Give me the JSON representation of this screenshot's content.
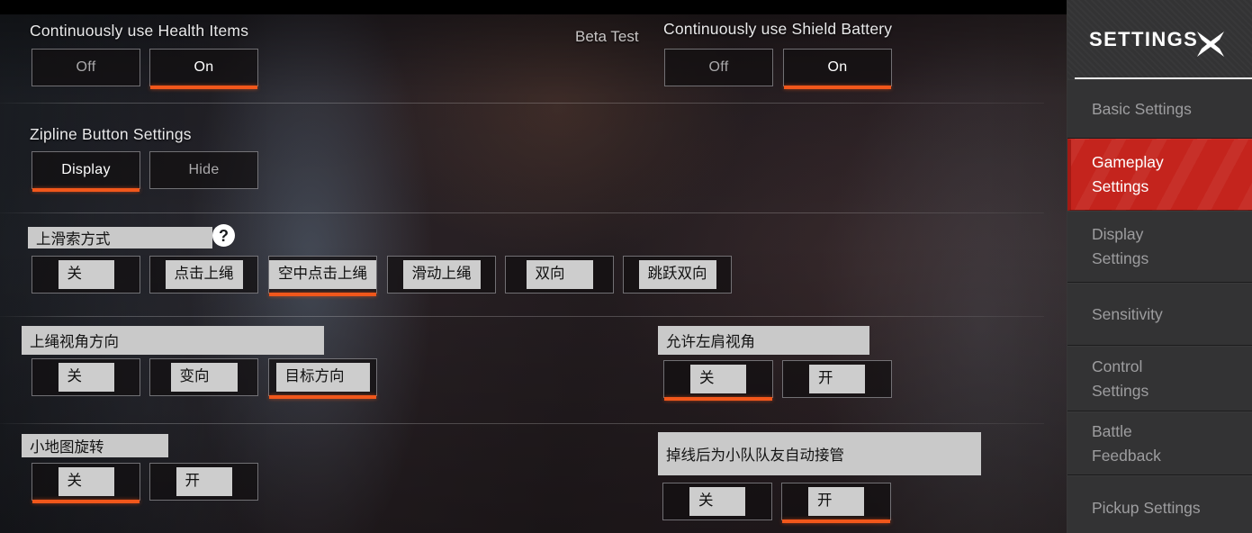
{
  "window": {
    "beta_label": "Beta Test"
  },
  "sidebar": {
    "title": "SETTINGS",
    "close_icon": "close-x-icon",
    "items": [
      {
        "label": "Basic Settings",
        "active": false
      },
      {
        "label": "Gameplay\nSettings",
        "active": true
      },
      {
        "label": "Display\nSettings",
        "active": false
      },
      {
        "label": "Sensitivity",
        "active": false
      },
      {
        "label": "Control\nSettings",
        "active": false
      },
      {
        "label": "Battle\nFeedback",
        "active": false
      },
      {
        "label": "Pickup Settings",
        "active": false
      }
    ]
  },
  "settings": [
    {
      "id": "continuously-use-health-items",
      "title": "Continuously use Health Items",
      "options": [
        {
          "label": "Off",
          "selected": false
        },
        {
          "label": "On",
          "selected": true
        }
      ]
    },
    {
      "id": "continuously-use-shield-battery",
      "title": "Continuously use Shield Battery",
      "options": [
        {
          "label": "Off",
          "selected": false
        },
        {
          "label": "On",
          "selected": true
        }
      ]
    },
    {
      "id": "zipline-button-settings",
      "title": "Zipline Button Settings",
      "options": [
        {
          "label": "Display",
          "selected": true
        },
        {
          "label": "Hide",
          "selected": false
        }
      ]
    },
    {
      "id": "zipline-mount-method",
      "title": "上滑索方式",
      "help_icon": "question-mark-icon",
      "options": [
        {
          "label": "关",
          "selected": false
        },
        {
          "label": "点击上绳",
          "selected": false
        },
        {
          "label": "空中点击上绳",
          "selected": true
        },
        {
          "label": "滑动上绳",
          "selected": false
        },
        {
          "label": "双向",
          "selected": false
        },
        {
          "label": "跳跃双向",
          "selected": false
        }
      ]
    },
    {
      "id": "zipline-camera-direction",
      "title": "上绳视角方向",
      "options": [
        {
          "label": "关",
          "selected": false
        },
        {
          "label": "变向",
          "selected": false
        },
        {
          "label": "目标方向",
          "selected": true
        }
      ]
    },
    {
      "id": "allow-left-shoulder-view",
      "title": "允许左肩视角",
      "options": [
        {
          "label": "关",
          "selected": true
        },
        {
          "label": "开",
          "selected": false
        }
      ]
    },
    {
      "id": "minimap-rotation",
      "title": "小地图旋转",
      "options": [
        {
          "label": "关",
          "selected": true
        },
        {
          "label": "开",
          "selected": false
        }
      ]
    },
    {
      "id": "auto-takeover-by-squadmate-on-disconnect",
      "title": "掉线后为小队队友自动接管",
      "options": [
        {
          "label": "关",
          "selected": false
        },
        {
          "label": "开",
          "selected": true
        }
      ]
    }
  ],
  "colors": {
    "accent_orange": "#f1571b",
    "active_red": "#c4241d",
    "chip_gray": "#cdcdcd",
    "sidebar_bg": "#333334"
  }
}
